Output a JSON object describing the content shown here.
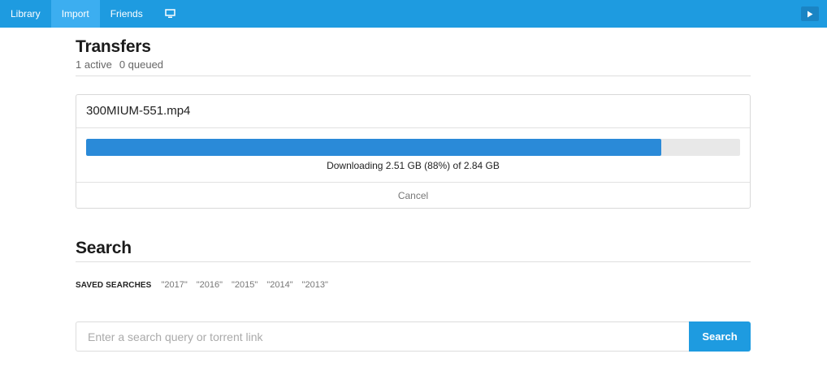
{
  "nav": {
    "items": [
      {
        "label": "Library",
        "active": false
      },
      {
        "label": "Import",
        "active": true
      },
      {
        "label": "Friends",
        "active": false
      }
    ],
    "monitor_icon": "monitor-icon",
    "play_icon": "play-icon"
  },
  "transfers": {
    "title": "Transfers",
    "active": "1 active",
    "queued": "0 queued",
    "item": {
      "file_name": "300MIUM-551.mp4",
      "progress": 0.88,
      "status": "Downloading 2.51 GB (88%) of 2.84 GB",
      "cancel_label": "Cancel"
    }
  },
  "search": {
    "title": "Search",
    "saved_label": "SAVED SEARCHES",
    "saved_items": [
      "\"2017\"",
      "\"2016\"",
      "\"2015\"",
      "\"2014\"",
      "\"2013\""
    ],
    "placeholder": "Enter a search query or torrent link",
    "value": "",
    "button_label": "Search"
  },
  "colors": {
    "accent": "#1e9be0",
    "nav_active": "#3caef0",
    "progress_fill": "#2a8ad8",
    "progress_track": "#e8e8e8"
  }
}
